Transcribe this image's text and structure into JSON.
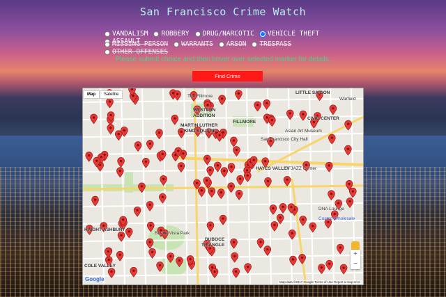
{
  "app": {
    "title": "San Francisco Crime Watch"
  },
  "categories_row1": [
    {
      "label": "VANDALISM",
      "selected": false
    },
    {
      "label": "ROBBERY",
      "selected": false
    },
    {
      "label": "DRUG/NARCOTIC",
      "selected": false
    },
    {
      "label": "VEHICLE THEFT",
      "selected": true
    },
    {
      "label": "ASSAULT",
      "selected": false
    }
  ],
  "categories_row2": [
    {
      "label": "MISSING PERSON",
      "selected": false
    },
    {
      "label": "WARRANTS",
      "selected": false
    },
    {
      "label": "ARSON",
      "selected": false
    },
    {
      "label": "TRESPASS",
      "selected": false
    },
    {
      "label": "OTHER OFFENSES",
      "selected": false
    }
  ],
  "instruction": "Please submit choice and then hover over selected marker for details.",
  "find_button": "Find Crime",
  "map": {
    "type_map": "Map",
    "type_satellite": "Satellite",
    "zoom_in": "+",
    "zoom_out": "−",
    "logo": "Google",
    "attribution": "Map data ©2017 Google  Terms of Use  Report a map error",
    "labels": {
      "fillmore": "The Fillmore",
      "western": "WESTERN",
      "addition": "ADDITION",
      "mlk": "MARTIN LUTHER",
      "king": "KING SQUARE",
      "civic": "CIVIC CENTER",
      "haight": "HAIGHT-ASHBURY",
      "cole": "COLE VALLEY",
      "duboce": "DUBOCE",
      "triangle": "TRIANGLE",
      "hayes": "HAYES VALLEY",
      "buena": "Buena Vista Park",
      "costco": "Costco Wholesale",
      "asian": "Asian Art Museum",
      "sfcityhall": "San Francisco City Hall",
      "warfield": "Warfield",
      "sfjazz": "SFJAZZ Center",
      "little": "LITTLE SAIGON",
      "fillmore2": "FILLMORE",
      "dna": "DNA Lounge"
    }
  },
  "colors": {
    "marker": "#e53935",
    "title": "#b7f0f0",
    "instruction": "#4cd18a",
    "button": "#ff1a1a"
  }
}
